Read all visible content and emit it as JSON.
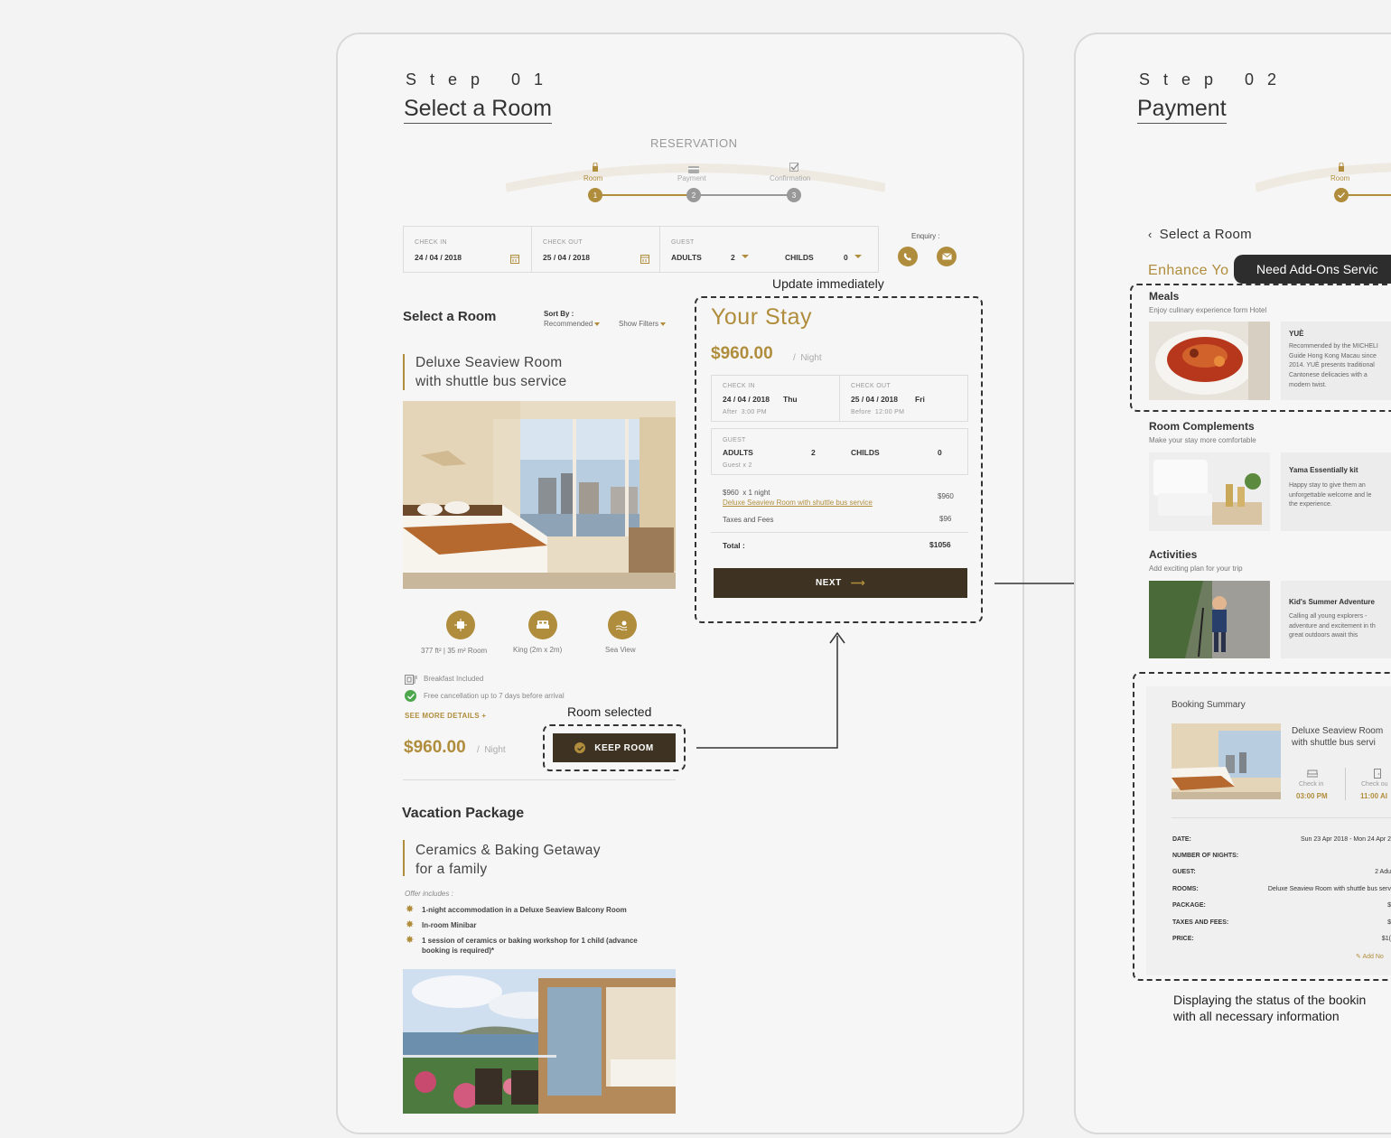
{
  "step1": {
    "step_label": "S t e p   0 1",
    "title": "Select a Room",
    "reservation": "RESERVATION",
    "progress": [
      {
        "label": "Room",
        "num": "1"
      },
      {
        "label": "Payment",
        "num": "2"
      },
      {
        "label": "Confirmation",
        "num": "3"
      }
    ],
    "booking_bar": {
      "checkin_label": "CHECK IN",
      "checkin_value": "24 / 04 / 2018",
      "checkout_label": "CHECK OUT",
      "checkout_value": "25 / 04 / 2018",
      "guest_label": "GUEST",
      "adults_label": "ADULTS",
      "adults_value": "2",
      "childs_label": "CHILDS",
      "childs_value": "0",
      "enquiry": "Enquiry :"
    },
    "list_title": "Select a Room",
    "sort_label": "Sort By :",
    "sort_value": "Recommended",
    "filters": "Show Filters",
    "room": {
      "name_line1": "Deluxe Seaview Room",
      "name_line2": "with shuttle bus service",
      "features": [
        "377 ft² | 35 m² Room",
        "King (2m x 2m)",
        "Sea View"
      ],
      "breakfast": "Breakfast Included",
      "cancellation": "Free cancellation up to 7 days before arrival",
      "see_more": "SEE MORE DETAILS +",
      "price": "$960.00",
      "per": "/  Night",
      "keep_button": "KEEP ROOM"
    },
    "vacation": {
      "title": "Vacation Package",
      "name_line1": "Ceramics & Baking Getaway",
      "name_line2": "for a family",
      "offer_label": "Offer includes :",
      "offers": [
        "1-night accommodation in a Deluxe Seaview Balcony Room",
        "In-room Minibar",
        "1 session of ceramics or baking workshop for 1 child (advance",
        "booking is required)*"
      ]
    }
  },
  "annotations": {
    "update": "Update immediately",
    "room_selected": "Room selected",
    "addons": "Need Add-Ons Servic",
    "status_line1": "Displaying the status of the bookin",
    "status_line2": "with all necessary information"
  },
  "your_stay": {
    "title": "Your Stay",
    "price": "$960.00",
    "per": "/  Night",
    "checkin_label": "CHECK IN",
    "checkin_value": "24 / 04 / 2018",
    "checkin_day": "Thu",
    "checkin_note": "After  3:00 PM",
    "checkout_label": "CHECK OUT",
    "checkout_value": "25 / 04 / 2018",
    "checkout_day": "Fri",
    "checkout_note": "Before  12:00 PM",
    "guest_label": "GUEST",
    "adults_label": "ADULTS",
    "adults_value": "2",
    "childs_label": "CHILDS",
    "childs_value": "0",
    "guest_note": "Guest x 2",
    "line1_label": "$960  x 1 night",
    "line1_link": "Deluxe Seaview Room with shuttle bus service",
    "line1_value": "$960",
    "taxes_label": "Taxes and Fees",
    "taxes_value": "$96",
    "total_label": "Total :",
    "total_value": "$1056",
    "next_button": "NEXT"
  },
  "step2": {
    "step_label": "S t e p   0 2",
    "title": "Payment",
    "progress_room": "Room",
    "back_link": "Select a Room",
    "enhance": "Enhance Yo",
    "meals": {
      "title": "Meals",
      "sub": "Enjoy culinary experience form Hotel",
      "item_title": "YUÈ",
      "item_desc": [
        "Recommended by the MICHELI",
        "Guide Hong Kong Macau since",
        "2014. YUÈ presents traditional",
        "Cantonese delicacies with a",
        "modern twist."
      ]
    },
    "complements": {
      "title": "Room Complements",
      "sub": "Make your stay more comfortable",
      "item_title": "Yama Essentially kit",
      "item_desc": [
        "Happy stay to give them an",
        "unforgettable welcome and le",
        "the experience."
      ]
    },
    "activities": {
      "title": "Activities",
      "sub": "Add exciting plan for your trip",
      "item_title": "Kid's Summer Adventure",
      "item_desc": [
        "Calling all young explorers -",
        "adventure and excitement in th",
        "great outdoors await this"
      ]
    },
    "summary": {
      "title": "Booking Summary",
      "room_line1": "Deluxe Seaview Room",
      "room_line2": "with shuttle bus servi",
      "checkin_label": "Check in",
      "checkin_time": "03:00 PM",
      "checkout_label": "Check ou",
      "checkout_time": "11:00 AI",
      "rows": [
        {
          "label": "DATE:",
          "value": "Sun 23 Apr 2018 - Mon 24 Apr 2"
        },
        {
          "label": "NUMBER OF NIGHTS:",
          "value": ""
        },
        {
          "label": "GUEST:",
          "value": "2 Adu"
        },
        {
          "label": "ROOMS:",
          "value": "Deluxe Seaview Room with shuttle bus serv"
        },
        {
          "label": "PACKAGE:",
          "value": "$"
        },
        {
          "label": "TAXES AND FEES:",
          "value": "$"
        },
        {
          "label": "PRICE:",
          "value": "$1("
        }
      ],
      "add_note": "Add No"
    }
  },
  "colors": {
    "accent": "#b08d3c",
    "dark": "#3e3322",
    "background": "#f3f3f3"
  }
}
